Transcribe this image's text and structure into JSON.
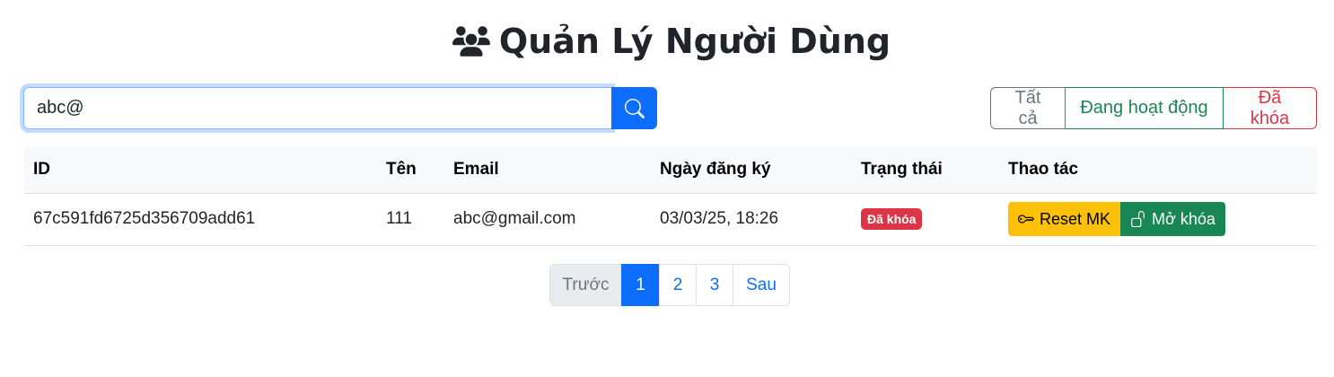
{
  "header": {
    "title": "Quản Lý Người Dùng",
    "icon": "users-icon"
  },
  "search": {
    "value": "abc@",
    "placeholder": "",
    "button_icon": "search-icon"
  },
  "filters": {
    "all": "Tất cả",
    "active": "Đang hoạt động",
    "locked": "Đã khóa"
  },
  "table": {
    "headers": {
      "id": "ID",
      "name": "Tên",
      "email": "Email",
      "registered": "Ngày đăng ký",
      "status": "Trạng thái",
      "actions": "Thao tác"
    },
    "rows": [
      {
        "id": "67c591fd6725d356709add61",
        "name": "111",
        "email": "abc@gmail.com",
        "registered": "03/03/25, 18:26",
        "status": "Đã khóa",
        "reset_label": "Reset MK",
        "unlock_label": "Mở khóa"
      }
    ]
  },
  "pagination": {
    "prev": "Trước",
    "pages": [
      "1",
      "2",
      "3"
    ],
    "next": "Sau",
    "current": "1"
  },
  "colors": {
    "primary": "#0d6efd",
    "success": "#198754",
    "danger": "#dc3545",
    "warning": "#ffc107",
    "secondary": "#6c757d"
  }
}
